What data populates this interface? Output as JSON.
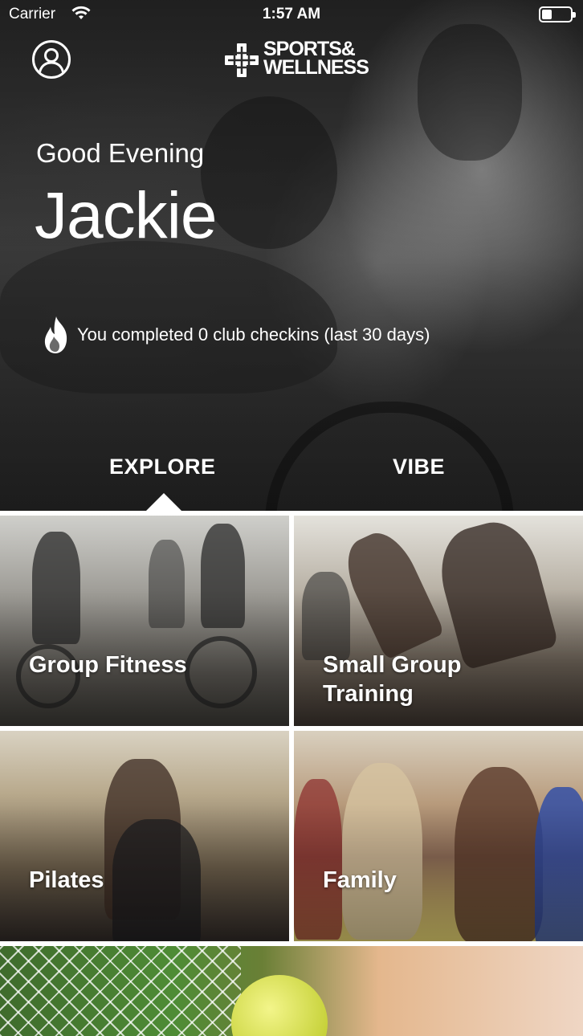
{
  "status_bar": {
    "carrier": "Carrier",
    "time": "1:57 AM"
  },
  "header": {
    "logo_line1": "SPORTS&",
    "logo_line2": "WELLNESS",
    "profile_icon": "person-circle-icon"
  },
  "hero": {
    "greeting": "Good Evening",
    "name": "Jackie",
    "checkins_text": "You completed 0 club checkins (last 30 days)",
    "checkins_icon": "flame-icon"
  },
  "tabs": [
    {
      "label": "EXPLORE",
      "selected": true
    },
    {
      "label": "VIBE",
      "selected": false
    }
  ],
  "tiles": [
    {
      "label_line1": "Group Fitness",
      "label_line2": ""
    },
    {
      "label_line1": "Small Group",
      "label_line2": "Training"
    },
    {
      "label_line1": "Pilates",
      "label_line2": ""
    },
    {
      "label_line1": "Family",
      "label_line2": ""
    },
    {
      "label_line1": "",
      "label_line2": ""
    }
  ],
  "colors": {
    "text": "#ffffff",
    "divider": "#ffffff"
  }
}
